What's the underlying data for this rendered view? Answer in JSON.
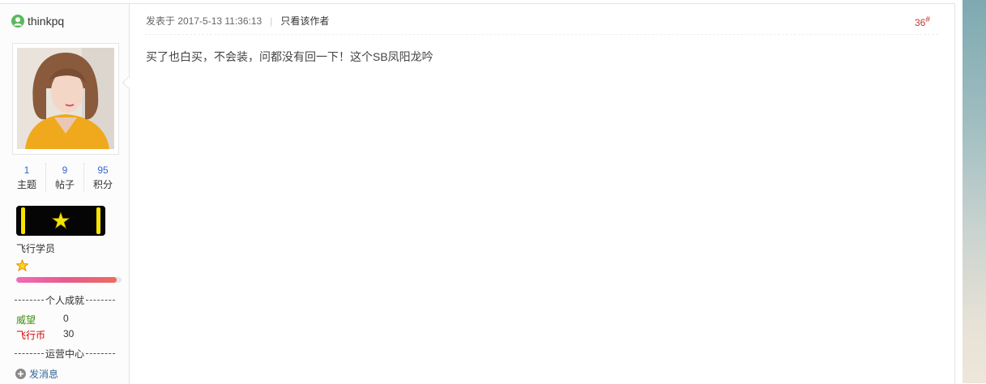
{
  "author": {
    "name": "thinkpq",
    "stats": [
      {
        "value": "1",
        "label": "主题"
      },
      {
        "value": "9",
        "label": "帖子"
      },
      {
        "value": "95",
        "label": "积分"
      }
    ],
    "rank_title": "飞行学员",
    "level_progress_percent": 95,
    "achievements_header": "个人成就",
    "achievements": [
      {
        "label": "威望",
        "value": "0",
        "color": "#3d8d0e"
      },
      {
        "label": "飞行币",
        "value": "30",
        "color": "#dd0000"
      }
    ],
    "operations_header": "运营中心",
    "send_message_label": "发消息"
  },
  "post": {
    "published_label": "发表于 2017-5-13 11:36:13",
    "separator": "|",
    "only_author_label": "只看该作者",
    "floor_number": "36",
    "floor_suffix": "#",
    "content": "买了也白买，不会装，问都没有回一下！这个SB凤阳龙吟"
  },
  "colors": {
    "accent_link": "#336699",
    "floor": "#cc3333",
    "stat_number": "#3366cc"
  }
}
